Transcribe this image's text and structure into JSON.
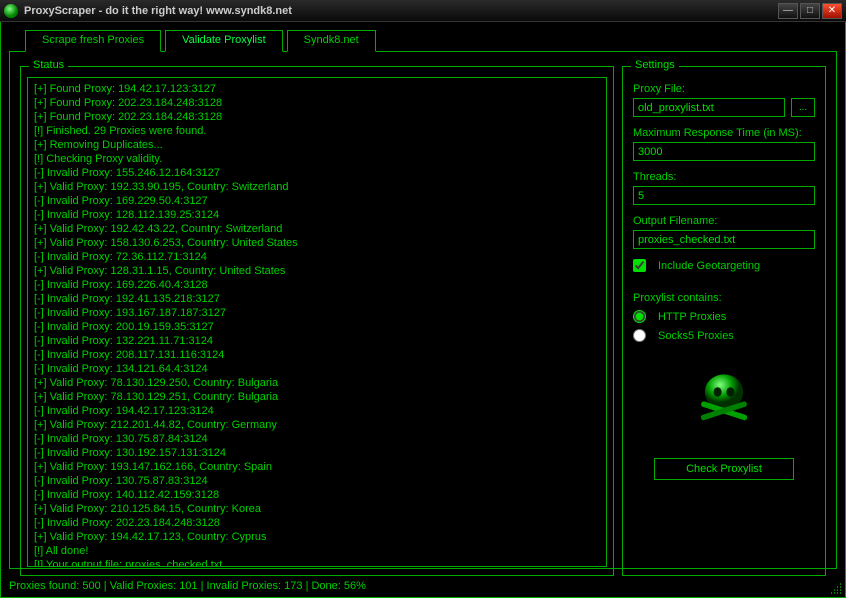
{
  "window": {
    "title": "ProxyScraper - do it the right way! www.syndk8.net"
  },
  "tabs": [
    {
      "label": "Scrape fresh Proxies",
      "active": false
    },
    {
      "label": "Validate Proxylist",
      "active": true
    },
    {
      "label": "Syndk8.net",
      "active": false
    }
  ],
  "status": {
    "legend": "Status",
    "lines": [
      "[+] Found Proxy: 194.42.17.123:3127",
      "[+] Found Proxy: 202.23.184.248:3128",
      "[+] Found Proxy: 202.23.184.248:3128",
      "[!] Finished. 29 Proxies were found.",
      "[+] Removing Duplicates...",
      "[!] Checking Proxy validity.",
      "[-] Invalid Proxy: 155.246.12.164:3127",
      "[+] Valid Proxy: 192.33.90.195, Country: Switzerland",
      "[-] Invalid Proxy: 169.229.50.4:3127",
      "[-] Invalid Proxy: 128.112.139.25:3124",
      "[+] Valid Proxy: 192.42.43.22, Country: Switzerland",
      "[+] Valid Proxy: 158.130.6.253, Country: United States",
      "[-] Invalid Proxy: 72.36.112.71:3124",
      "[+] Valid Proxy: 128.31.1.15, Country: United States",
      "[-] Invalid Proxy: 169.226.40.4:3128",
      "[-] Invalid Proxy: 192.41.135.218:3127",
      "[-] Invalid Proxy: 193.167.187.187:3127",
      "[-] Invalid Proxy: 200.19.159.35:3127",
      "[-] Invalid Proxy: 132.221.11.71:3124",
      "[-] Invalid Proxy: 208.117.131.116:3124",
      "[-] Invalid Proxy: 134.121.64.4:3124",
      "[+] Valid Proxy: 78.130.129.250, Country: Bulgaria",
      "[+] Valid Proxy: 78.130.129.251, Country: Bulgaria",
      "[-] Invalid Proxy: 194.42.17.123:3124",
      "[+] Valid Proxy: 212.201.44.82, Country: Germany",
      "[-] Invalid Proxy: 130.75.87.84:3124",
      "[-] Invalid Proxy: 130.192.157.131:3124",
      "[+] Valid Proxy: 193.147.162.166, Country: Spain",
      "[-] Invalid Proxy: 130.75.87.83:3124",
      "[-] Invalid Proxy: 140.112.42.159:3128",
      "[+] Valid Proxy: 210.125.84.15, Country: Korea",
      "[-] Invalid Proxy: 202.23.184.248:3128",
      "[+] Valid Proxy: 194.42.17.123, Country: Cyprus",
      "[!] All done!",
      "[!] Your output file: proxies_checked.txt"
    ]
  },
  "settings": {
    "legend": "Settings",
    "proxy_file_label": "Proxy File:",
    "proxy_file_value": "old_proxylist.txt",
    "browse_label": "...",
    "max_response_label": "Maximum Response Time (in MS):",
    "max_response_value": "3000",
    "threads_label": "Threads:",
    "threads_value": "5",
    "output_label": "Output Filename:",
    "output_value": "proxies_checked.txt",
    "geotarget_label": "Include Geotargeting",
    "proxylist_contains_label": "Proxylist contains:",
    "radio_http": "HTTP Proxies",
    "radio_socks": "Socks5 Proxies",
    "check_button": "Check Proxylist"
  },
  "statusbar": {
    "text": "Proxies found: 500 | Valid Proxies: 101 | Invalid Proxies: 173 | Done: 56%"
  }
}
